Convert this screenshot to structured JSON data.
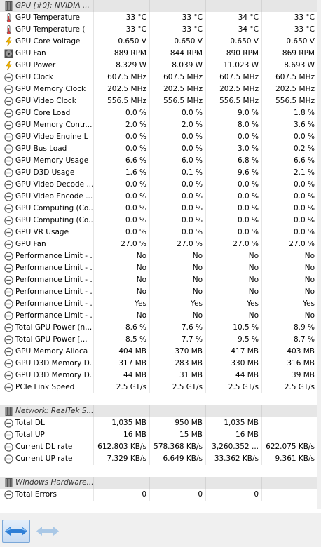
{
  "colors": {
    "accent": "#3a8ee6",
    "header_bg": "#e6e6e6",
    "voltage_icon": "#f0b400",
    "fan_icon": "#505050"
  },
  "rows": [
    {
      "kind": "header",
      "name": "GPU [#0]: NVIDIA ...",
      "icon": "gpu-chip-icon"
    },
    {
      "kind": "data",
      "name": "GPU Temperature",
      "icon": "thermometer-icon",
      "values": [
        "33 °C",
        "33 °C",
        "34 °C",
        "33 °C"
      ]
    },
    {
      "kind": "data",
      "name": "GPU Temperature (",
      "icon": "thermometer-icon",
      "values": [
        "33 °C",
        "33 °C",
        "34 °C",
        "33 °C"
      ]
    },
    {
      "kind": "data",
      "name": "GPU Core Voltage",
      "icon": "lightning-icon",
      "values": [
        "0.650 V",
        "0.650 V",
        "0.650 V",
        "0.650 V"
      ]
    },
    {
      "kind": "data",
      "name": "GPU Fan",
      "icon": "fan-icon",
      "values": [
        "889 RPM",
        "844 RPM",
        "890 RPM",
        "869 RPM"
      ]
    },
    {
      "kind": "data",
      "name": "GPU Power",
      "icon": "lightning-icon",
      "values": [
        "8.329 W",
        "8.039 W",
        "11.023 W",
        "8.693 W"
      ]
    },
    {
      "kind": "data",
      "name": "GPU Clock",
      "icon": "clock-icon",
      "values": [
        "607.5 MHz",
        "607.5 MHz",
        "607.5 MHz",
        "607.5 MHz"
      ]
    },
    {
      "kind": "data",
      "name": "GPU Memory Clock",
      "icon": "clock-icon",
      "values": [
        "202.5 MHz",
        "202.5 MHz",
        "202.5 MHz",
        "202.5 MHz"
      ]
    },
    {
      "kind": "data",
      "name": "GPU Video Clock",
      "icon": "clock-icon",
      "values": [
        "556.5 MHz",
        "556.5 MHz",
        "556.5 MHz",
        "556.5 MHz"
      ]
    },
    {
      "kind": "data",
      "name": "GPU Core Load",
      "icon": "gauge-icon",
      "values": [
        "0.0 %",
        "0.0 %",
        "9.0 %",
        "1.8 %"
      ]
    },
    {
      "kind": "data",
      "name": "GPU Memory Contr...",
      "icon": "gauge-icon",
      "values": [
        "2.0 %",
        "2.0 %",
        "8.0 %",
        "3.6 %"
      ]
    },
    {
      "kind": "data",
      "name": "GPU Video Engine L",
      "icon": "gauge-icon",
      "values": [
        "0.0 %",
        "0.0 %",
        "0.0 %",
        "0.0 %"
      ]
    },
    {
      "kind": "data",
      "name": "GPU Bus Load",
      "icon": "gauge-icon",
      "values": [
        "0.0 %",
        "0.0 %",
        "3.0 %",
        "0.2 %"
      ]
    },
    {
      "kind": "data",
      "name": "GPU Memory Usage",
      "icon": "gauge-icon",
      "values": [
        "6.6 %",
        "6.0 %",
        "6.8 %",
        "6.6 %"
      ]
    },
    {
      "kind": "data",
      "name": "GPU D3D Usage",
      "icon": "gauge-icon",
      "values": [
        "1.6 %",
        "0.1 %",
        "9.6 %",
        "2.1 %"
      ]
    },
    {
      "kind": "data",
      "name": "GPU Video Decode ...",
      "icon": "gauge-icon",
      "values": [
        "0.0 %",
        "0.0 %",
        "0.0 %",
        "0.0 %"
      ]
    },
    {
      "kind": "data",
      "name": "GPU Video Encode ...",
      "icon": "gauge-icon",
      "values": [
        "0.0 %",
        "0.0 %",
        "0.0 %",
        "0.0 %"
      ]
    },
    {
      "kind": "data",
      "name": "GPU Computing (Co...",
      "icon": "gauge-icon",
      "values": [
        "0.0 %",
        "0.0 %",
        "0.0 %",
        "0.0 %"
      ]
    },
    {
      "kind": "data",
      "name": "GPU Computing (Co...",
      "icon": "gauge-icon",
      "values": [
        "0.0 %",
        "0.0 %",
        "0.0 %",
        "0.0 %"
      ]
    },
    {
      "kind": "data",
      "name": "GPU VR Usage",
      "icon": "gauge-icon",
      "values": [
        "0.0 %",
        "0.0 %",
        "0.0 %",
        "0.0 %"
      ]
    },
    {
      "kind": "data",
      "name": "GPU Fan",
      "icon": "gauge-icon",
      "values": [
        "27.0 %",
        "27.0 %",
        "27.0 %",
        "27.0 %"
      ]
    },
    {
      "kind": "data",
      "name": "Performance Limit - ...",
      "icon": "gauge-icon",
      "values": [
        "No",
        "No",
        "No",
        "No"
      ]
    },
    {
      "kind": "data",
      "name": "Performance Limit - ...",
      "icon": "gauge-icon",
      "values": [
        "No",
        "No",
        "No",
        "No"
      ]
    },
    {
      "kind": "data",
      "name": "Performance Limit - ...",
      "icon": "gauge-icon",
      "values": [
        "No",
        "No",
        "No",
        "No"
      ]
    },
    {
      "kind": "data",
      "name": "Performance Limit - ...",
      "icon": "gauge-icon",
      "values": [
        "No",
        "No",
        "No",
        "No"
      ]
    },
    {
      "kind": "data",
      "name": "Performance Limit - ...",
      "icon": "gauge-icon",
      "values": [
        "Yes",
        "Yes",
        "Yes",
        "Yes"
      ]
    },
    {
      "kind": "data",
      "name": "Performance Limit - ...",
      "icon": "gauge-icon",
      "values": [
        "No",
        "No",
        "No",
        "No"
      ]
    },
    {
      "kind": "data",
      "name": "Total GPU Power (n...",
      "icon": "gauge-icon",
      "values": [
        "8.6 %",
        "7.6 %",
        "10.5 %",
        "8.9 %"
      ]
    },
    {
      "kind": "data",
      "name": "Total GPU Power [...",
      "icon": "gauge-icon",
      "values": [
        "8.5 %",
        "7.7 %",
        "9.5 %",
        "8.7 %"
      ]
    },
    {
      "kind": "data",
      "name": "GPU Memory Alloca",
      "icon": "gauge-icon",
      "values": [
        "404 MB",
        "370 MB",
        "417 MB",
        "403 MB"
      ]
    },
    {
      "kind": "data",
      "name": "GPU D3D Memory D...",
      "icon": "gauge-icon",
      "values": [
        "317 MB",
        "283 MB",
        "330 MB",
        "316 MB"
      ]
    },
    {
      "kind": "data",
      "name": "GPU D3D Memory D...",
      "icon": "gauge-icon",
      "values": [
        "44 MB",
        "31 MB",
        "44 MB",
        "39 MB"
      ]
    },
    {
      "kind": "data",
      "name": "PCIe Link Speed",
      "icon": "gauge-icon",
      "values": [
        "2.5 GT/s",
        "2.5 GT/s",
        "2.5 GT/s",
        "2.5 GT/s"
      ]
    },
    {
      "kind": "blank"
    },
    {
      "kind": "header",
      "name": "Network: RealTek S...",
      "icon": "network-card-icon"
    },
    {
      "kind": "data",
      "name": "Total DL",
      "icon": "gauge-icon",
      "values": [
        "1,035 MB",
        "950 MB",
        "1,035 MB",
        ""
      ]
    },
    {
      "kind": "data",
      "name": "Total UP",
      "icon": "gauge-icon",
      "values": [
        "16 MB",
        "15 MB",
        "16 MB",
        ""
      ]
    },
    {
      "kind": "data",
      "name": "Current DL rate",
      "icon": "gauge-icon",
      "values": [
        "612.803 KB/s",
        "578.368 KB/s",
        "3,260.352 ...",
        "622.075 KB/s"
      ]
    },
    {
      "kind": "data",
      "name": "Current UP rate",
      "icon": "gauge-icon",
      "values": [
        "7.329 KB/s",
        "6.649 KB/s",
        "33.362 KB/s",
        "9.361 KB/s"
      ]
    },
    {
      "kind": "blank"
    },
    {
      "kind": "header",
      "name": "Windows Hardware...",
      "icon": "hardware-chip-icon"
    },
    {
      "kind": "data",
      "name": "Total Errors",
      "icon": "gauge-icon",
      "values": [
        "0",
        "0",
        "0",
        ""
      ]
    }
  ],
  "toolbar": {
    "nav_left_icon": "arrows-left-right-icon",
    "nav_right_icon": "arrows-left-right-disabled-icon"
  }
}
